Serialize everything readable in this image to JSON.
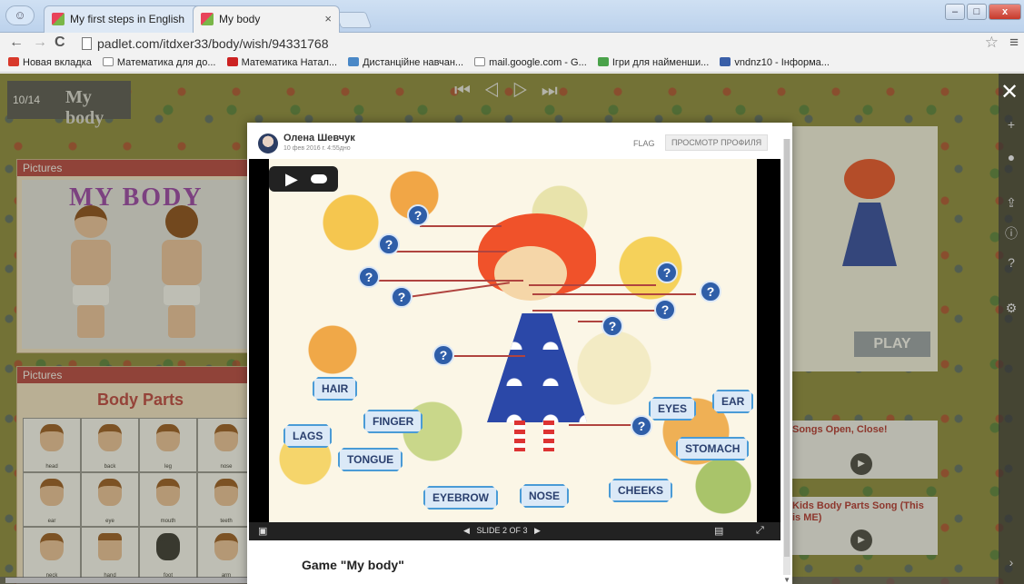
{
  "browser": {
    "tabs": [
      {
        "title": "My first steps in English"
      },
      {
        "title": "My body"
      }
    ],
    "url": "padlet.com/itdxer33/body/wish/94331768",
    "bookmarks": [
      {
        "label": "Новая вкладка",
        "color": "#d8392b"
      },
      {
        "label": "Математика для до...",
        "color": "#888888"
      },
      {
        "label": "Математика Натал...",
        "color": "#cc2222"
      },
      {
        "label": "Дистанційне навчан...",
        "color": "#4a88c7"
      },
      {
        "label": "mail.google.com - G...",
        "color": "#888888"
      },
      {
        "label": "Ігри для найменши...",
        "color": "#4aa24a"
      },
      {
        "label": "vndnz10 - Інформа...",
        "color": "#3a5fa8"
      }
    ]
  },
  "padlet": {
    "counter": "10/14",
    "board_title": "My body",
    "left_cards": [
      {
        "header": "Pictures",
        "title": "MY BODY"
      },
      {
        "header": "Pictures",
        "title": "Body Parts",
        "cells": [
          "head",
          "back",
          "leg",
          "nose",
          "ear",
          "eye",
          "mouth",
          "teeth",
          "neck",
          "hand",
          "foot",
          "arm"
        ]
      }
    ],
    "right_cards": {
      "play_label": "PLAY",
      "videos": [
        {
          "title": "Songs Open, Close!"
        },
        {
          "title": "Kids Body Parts Song (This is ME)"
        }
      ]
    }
  },
  "modal": {
    "author": "Олена Шевчук",
    "date": "10 фев 2016 г. 4:55дно",
    "flag_label": "FLAG",
    "profile_label": "ПРОСМОТР ПРОФИЛЯ",
    "slide_indicator": "SLIDE 2 OF 3",
    "post_title": "Game \"My body\"",
    "labels": [
      "HAIR",
      "FINGER",
      "LAGS",
      "TONGUE",
      "EYEBROW",
      "NOSE",
      "CHEEKS",
      "EYES",
      "EAR",
      "STOMACH"
    ],
    "question_mark": "?"
  }
}
